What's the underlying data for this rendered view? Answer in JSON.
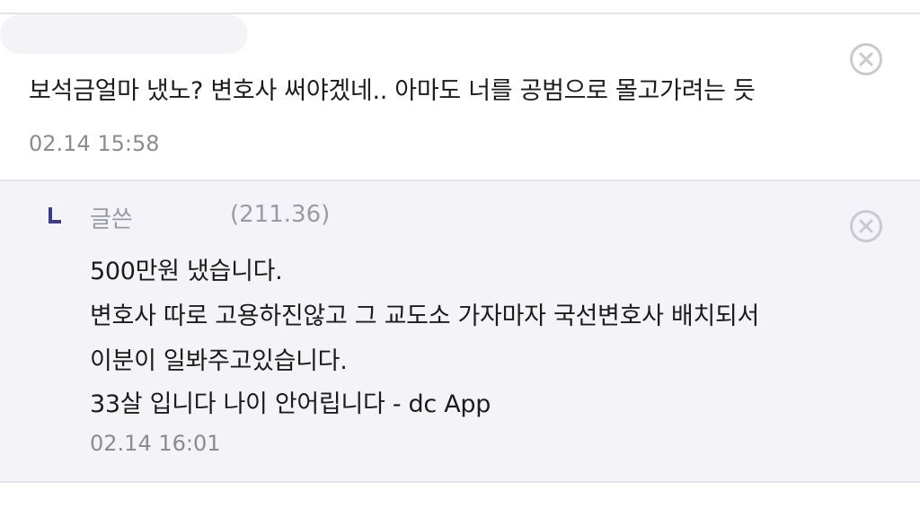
{
  "comment": {
    "text": "보석금얼마 냈노? 변호사 써야겠네.. 아마도 너를 공범으로 몰고가려는 듯",
    "timestamp": "02.14 15:58"
  },
  "reply": {
    "author": "글쓴",
    "ip": "(211.36)",
    "lines": [
      "500만원 냈습니다.",
      "변호사 따로 고용하진않고 그 교도소 가자마자 국선변호사 배치되서",
      "이분이 일봐주고있습니다.",
      "33살 입니다 나이 안어립니다 - dc App"
    ],
    "timestamp": "02.14 16:01"
  },
  "icons": {
    "delete": "close-circle-icon",
    "reply_marker": "reply-arrow-icon"
  },
  "colors": {
    "reply_background": "#f3f3f8",
    "reply_marker": "#3b3b8f",
    "muted_text": "#8c8c8c"
  }
}
